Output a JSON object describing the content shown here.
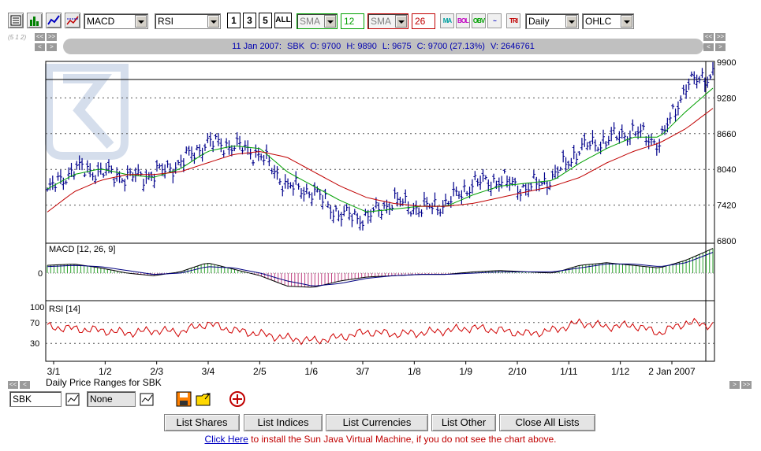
{
  "toolbar": {
    "icons": [
      "list-icon",
      "bar-chart-icon",
      "line-chart-icon",
      "crosshair-chart-icon"
    ],
    "indicator1": "MACD",
    "indicator2": "RSI",
    "period_buttons": [
      "1",
      "3",
      "5",
      "ALL"
    ],
    "ma1_type": "SMA",
    "ma1_period": "12",
    "ma2_type": "SMA",
    "ma2_period": "26",
    "overlay_buttons": [
      "MA",
      "BOL",
      "OBV",
      "~",
      "TRI"
    ],
    "interval": "Daily",
    "chart_style": "OHLC",
    "ma1_color": "#00a000",
    "ma2_color": "#c00000"
  },
  "scale_label": "(5 1 2)",
  "info_bar": {
    "date": "11 Jan 2007:",
    "code": "SBK",
    "open": "O: 9700",
    "high": "H: 9890",
    "low": "L: 9675",
    "close": "C: 9700 (27.13%)",
    "volume": "V: 2646761"
  },
  "nav": {
    "back_far": "<<",
    "forward_far": ">>",
    "back": "<",
    "forward": ">"
  },
  "chart_data": [
    {
      "type": "line",
      "title": "",
      "ylim": [
        6800,
        9900
      ],
      "yticks": [
        6800,
        7420,
        8040,
        8660,
        9280,
        9900
      ],
      "xtick_labels": [
        "3/1",
        "1/2",
        "2/3",
        "3/4",
        "2/5",
        "1/6",
        "3/7",
        "1/8",
        "1/9",
        "2/10",
        "1/11",
        "1/12",
        "2 Jan 2007"
      ],
      "x": [
        "2006-01-03",
        "2006-01-17",
        "2006-02-01",
        "2006-02-15",
        "2006-03-02",
        "2006-03-16",
        "2006-04-03",
        "2006-04-19",
        "2006-05-02",
        "2006-05-16",
        "2006-06-01",
        "2006-06-15",
        "2006-07-03",
        "2006-07-17",
        "2006-08-01",
        "2006-08-15",
        "2006-09-01",
        "2006-09-15",
        "2006-10-02",
        "2006-10-16",
        "2006-11-01",
        "2006-11-15",
        "2006-12-01",
        "2006-12-15",
        "2007-01-02",
        "2007-01-11"
      ],
      "series": [
        {
          "name": "",
          "values": [
            7650,
            8050,
            8000,
            7900,
            7950,
            8150,
            8500,
            8450,
            8300,
            7750,
            7650,
            7250,
            7200,
            7500,
            7350,
            7450,
            7800,
            7850,
            7700,
            7900,
            8400,
            8550,
            8700,
            8500,
            9500,
            9700
          ]
        },
        {
          "name": "",
          "values": [
            7700,
            7950,
            8050,
            7950,
            7900,
            8050,
            8350,
            8450,
            8400,
            8000,
            7750,
            7500,
            7300,
            7350,
            7400,
            7400,
            7600,
            7750,
            7800,
            7850,
            8150,
            8400,
            8600,
            8600,
            9050,
            9450
          ]
        },
        {
          "name": "",
          "values": [
            7300,
            7650,
            7850,
            7950,
            7950,
            8000,
            8150,
            8300,
            8350,
            8250,
            8000,
            7750,
            7550,
            7450,
            7400,
            7400,
            7450,
            7550,
            7650,
            7750,
            7900,
            8150,
            8350,
            8500,
            8750,
            9100
          ]
        }
      ],
      "hline": 9600
    },
    {
      "type": "line",
      "title": "MACD [12, 26, 9]",
      "zero_label": "0",
      "ylim": [
        -1,
        1
      ],
      "x_count": 26,
      "values": [
        0.3,
        0.35,
        0.2,
        0.0,
        -0.1,
        0.05,
        0.4,
        0.15,
        -0.1,
        -0.5,
        -0.55,
        -0.3,
        -0.15,
        -0.1,
        -0.05,
        -0.05,
        0.05,
        0.1,
        0.05,
        0.0,
        0.3,
        0.4,
        0.3,
        0.2,
        0.5,
        0.95
      ],
      "signal": [
        0.25,
        0.3,
        0.25,
        0.1,
        -0.05,
        0.0,
        0.25,
        0.2,
        0.0,
        -0.3,
        -0.5,
        -0.4,
        -0.2,
        -0.1,
        -0.05,
        -0.05,
        0.0,
        0.05,
        0.05,
        0.05,
        0.2,
        0.35,
        0.35,
        0.25,
        0.4,
        0.8
      ]
    },
    {
      "type": "line",
      "title": "RSI [14]",
      "ylim": [
        0,
        100
      ],
      "yticks": [
        30,
        70,
        100
      ],
      "x_count": 26,
      "values": [
        62,
        58,
        55,
        50,
        55,
        52,
        68,
        55,
        48,
        40,
        35,
        42,
        52,
        48,
        50,
        55,
        60,
        55,
        48,
        55,
        70,
        62,
        65,
        50,
        70,
        65
      ]
    }
  ],
  "pane_caption": {
    "line1": "Daily Price Ranges  for SBK"
  },
  "bottom": {
    "code_value": "SBK",
    "compare_value": "None"
  },
  "list_buttons": [
    "List Shares",
    "List Indices",
    "List Currencies",
    "List Other",
    "Close All Lists"
  ],
  "java_note": {
    "link": "Click Here",
    "text": " to install the Sun Java Virtual Machine, if you do not see the chart above."
  },
  "colors": {
    "price": "#00008b",
    "macd_hist": "#2aa02a",
    "macd_line": "#000080",
    "rsi_line": "#d00000",
    "grid": "#555555"
  }
}
